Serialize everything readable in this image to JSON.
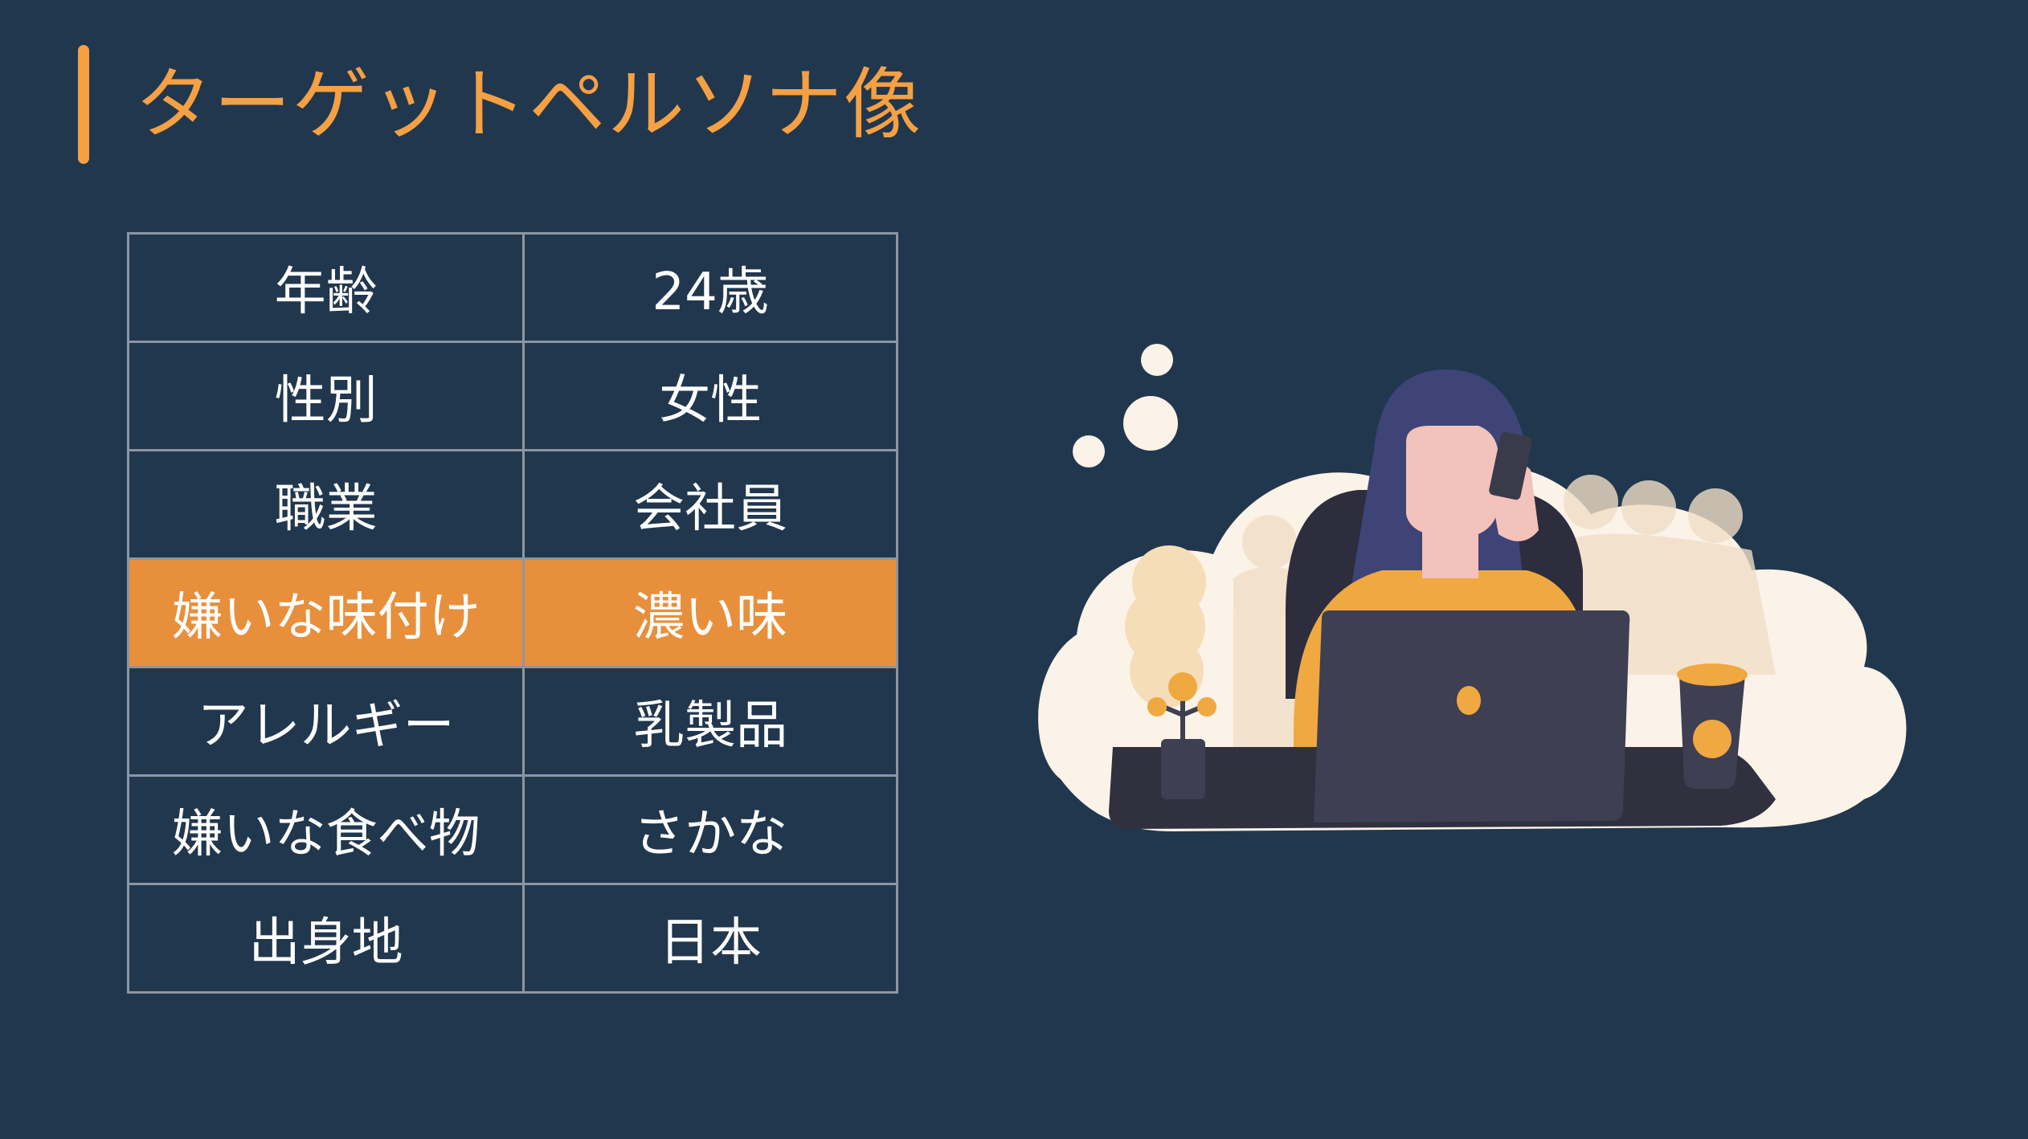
{
  "slide": {
    "title": "ターゲットペルソナ像"
  },
  "persona_table": {
    "rows": [
      {
        "label": "年齢",
        "value": "24歳",
        "highlight": false
      },
      {
        "label": "性別",
        "value": "女性",
        "highlight": false
      },
      {
        "label": "職業",
        "value": "会社員",
        "highlight": false
      },
      {
        "label": "嫌いな味付け",
        "value": "濃い味",
        "highlight": true
      },
      {
        "label": "アレルギー",
        "value": "乳製品",
        "highlight": false
      },
      {
        "label": "嫌いな食べ物",
        "value": "さかな",
        "highlight": false
      },
      {
        "label": "出身地",
        "value": "日本",
        "highlight": false
      }
    ]
  },
  "colors": {
    "background": "#21374e",
    "accent": "#f5a043",
    "highlight_row": "#e88f3c",
    "table_border": "#8c96a2",
    "text": "#ffffff"
  },
  "illustration": {
    "icon": "woman-on-phone-with-laptop-illustration"
  }
}
